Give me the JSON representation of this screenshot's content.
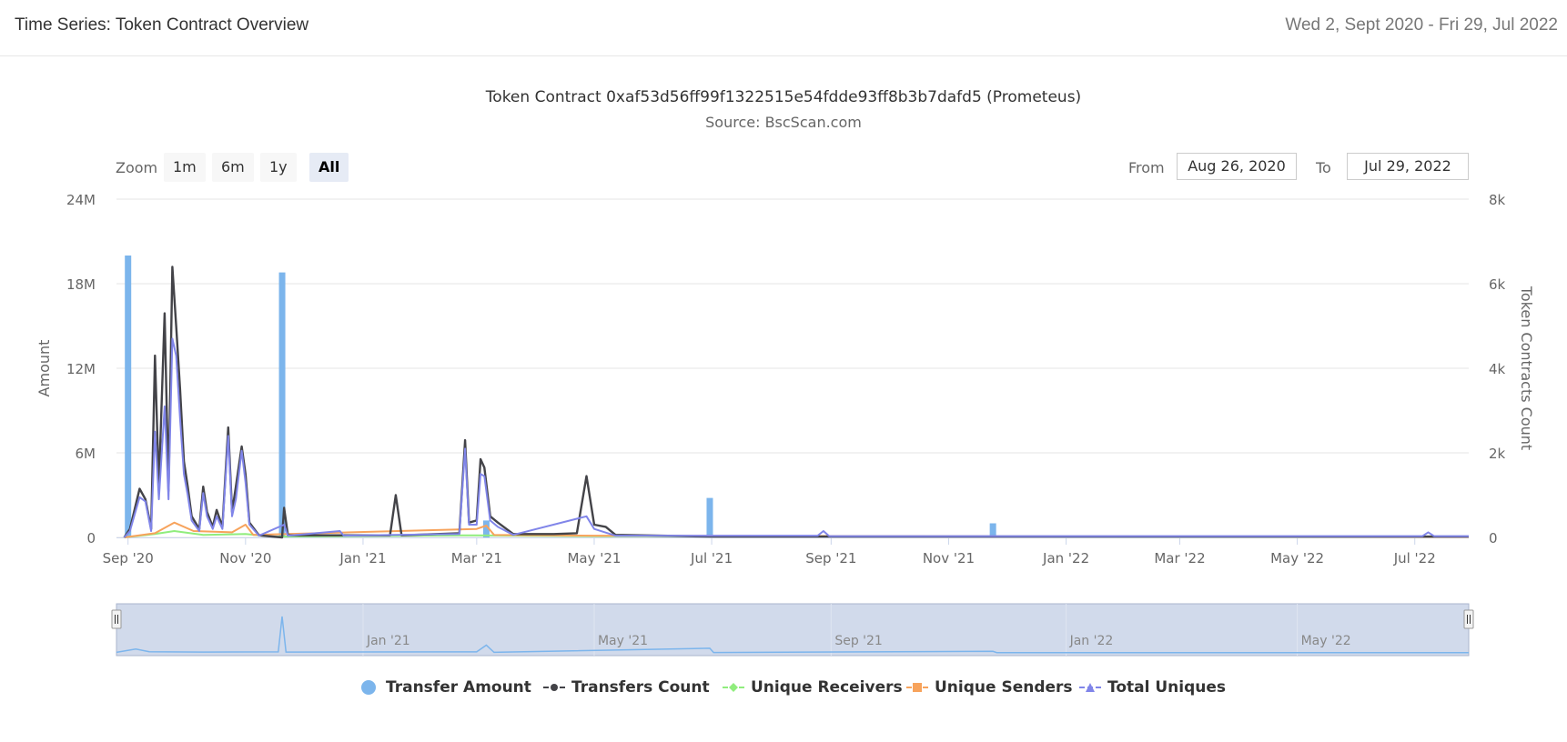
{
  "header": {
    "title": "Time Series: Token Contract Overview",
    "date_range": "Wed 2, Sept 2020 - Fri 29, Jul 2022"
  },
  "range_selector": {
    "zoom_label": "Zoom",
    "buttons": [
      "1m",
      "6m",
      "1y",
      "All"
    ],
    "active": "All",
    "from_label": "From",
    "from_value": "Aug 26, 2020",
    "to_label": "To",
    "to_value": "Jul 29, 2022"
  },
  "colors": {
    "transfer_amount": "#7cb5ec",
    "transfers_count": "#434348",
    "unique_receivers": "#90ed7d",
    "unique_senders": "#f7a35c",
    "total_uniques": "#8085e9",
    "grid": "#e6e6e6",
    "navigator_fill": "#c9d3e8"
  },
  "chart_data": {
    "type": "line",
    "title": "Token Contract 0xaf53d56ff99f1322515e54fdde93ff8b3b7dafd5 (Prometeus)",
    "subtitle": "Source: BscScan.com",
    "xlabel": "",
    "ylabel": "Amount",
    "y2label": "Token Contracts Count",
    "xlim": [
      "2020-08-26",
      "2022-07-29"
    ],
    "ylim": [
      0,
      24000000
    ],
    "y2lim": [
      0,
      8000
    ],
    "x_tick_labels": [
      "Sep '20",
      "Nov '20",
      "Jan '21",
      "Mar '21",
      "May '21",
      "Jul '21",
      "Sep '21",
      "Nov '21",
      "Jan '22",
      "Mar '22",
      "May '22",
      "Jul '22"
    ],
    "x_tick_dates": [
      "2020-09-01",
      "2020-11-01",
      "2021-01-01",
      "2021-03-01",
      "2021-05-01",
      "2021-07-01",
      "2021-09-01",
      "2021-11-01",
      "2022-01-01",
      "2022-03-01",
      "2022-05-01",
      "2022-07-01"
    ],
    "y_tick_labels": [
      "0",
      "6M",
      "12M",
      "18M",
      "24M"
    ],
    "y2_tick_labels": [
      "0",
      "2k",
      "4k",
      "6k",
      "8k"
    ],
    "grid": true,
    "legend_position": "bottom-center",
    "navigator_labels": [
      "Jan '21",
      "May '21",
      "Sep '21",
      "Jan '22",
      "May '22"
    ],
    "series": [
      {
        "name": "Transfer Amount",
        "type": "column",
        "axis": "left",
        "points": [
          [
            "2020-09-01",
            20000000
          ],
          [
            "2020-11-20",
            18800000
          ],
          [
            "2021-03-06",
            1200000
          ],
          [
            "2021-06-30",
            2800000
          ],
          [
            "2021-11-24",
            1000000
          ]
        ]
      },
      {
        "name": "Transfers Count",
        "type": "line",
        "axis": "right",
        "points": [
          [
            "2020-08-30",
            0
          ],
          [
            "2020-09-02",
            200
          ],
          [
            "2020-09-07",
            1150
          ],
          [
            "2020-09-10",
            900
          ],
          [
            "2020-09-13",
            200
          ],
          [
            "2020-09-15",
            4300
          ],
          [
            "2020-09-17",
            1200
          ],
          [
            "2020-09-20",
            5300
          ],
          [
            "2020-09-22",
            1100
          ],
          [
            "2020-09-24",
            6400
          ],
          [
            "2020-09-26",
            5000
          ],
          [
            "2020-09-28",
            3500
          ],
          [
            "2020-09-30",
            1800
          ],
          [
            "2020-10-02",
            1200
          ],
          [
            "2020-10-04",
            500
          ],
          [
            "2020-10-08",
            200
          ],
          [
            "2020-10-10",
            1200
          ],
          [
            "2020-10-12",
            600
          ],
          [
            "2020-10-15",
            250
          ],
          [
            "2020-10-17",
            650
          ],
          [
            "2020-10-20",
            250
          ],
          [
            "2020-10-23",
            2600
          ],
          [
            "2020-10-25",
            600
          ],
          [
            "2020-10-27",
            1200
          ],
          [
            "2020-10-30",
            2150
          ],
          [
            "2020-11-01",
            1500
          ],
          [
            "2020-11-03",
            350
          ],
          [
            "2020-11-08",
            50
          ],
          [
            "2020-11-20",
            0
          ],
          [
            "2020-11-21",
            700
          ],
          [
            "2020-11-23",
            50
          ],
          [
            "2020-12-15",
            50
          ],
          [
            "2021-01-15",
            50
          ],
          [
            "2021-01-18",
            1000
          ],
          [
            "2021-01-21",
            50
          ],
          [
            "2021-02-20",
            100
          ],
          [
            "2021-02-23",
            2300
          ],
          [
            "2021-02-25",
            350
          ],
          [
            "2021-03-01",
            400
          ],
          [
            "2021-03-03",
            1850
          ],
          [
            "2021-03-05",
            1650
          ],
          [
            "2021-03-08",
            500
          ],
          [
            "2021-03-12",
            350
          ],
          [
            "2021-03-20",
            80
          ],
          [
            "2021-04-10",
            80
          ],
          [
            "2021-04-22",
            100
          ],
          [
            "2021-04-27",
            1450
          ],
          [
            "2021-05-01",
            300
          ],
          [
            "2021-05-07",
            250
          ],
          [
            "2021-05-12",
            60
          ],
          [
            "2021-07-01",
            20
          ],
          [
            "2022-07-29",
            20
          ]
        ]
      },
      {
        "name": "Unique Receivers",
        "type": "line",
        "axis": "right",
        "points": [
          [
            "2020-08-30",
            0
          ],
          [
            "2020-09-15",
            80
          ],
          [
            "2020-09-25",
            150
          ],
          [
            "2020-10-10",
            60
          ],
          [
            "2020-11-01",
            80
          ],
          [
            "2020-11-15",
            20
          ],
          [
            "2021-03-01",
            50
          ],
          [
            "2021-05-01",
            30
          ],
          [
            "2022-07-29",
            10
          ]
        ]
      },
      {
        "name": "Unique Senders",
        "type": "line",
        "axis": "right",
        "points": [
          [
            "2020-08-30",
            0
          ],
          [
            "2020-09-15",
            100
          ],
          [
            "2020-09-25",
            350
          ],
          [
            "2020-10-05",
            150
          ],
          [
            "2020-10-25",
            120
          ],
          [
            "2020-11-01",
            300
          ],
          [
            "2020-11-05",
            60
          ],
          [
            "2021-03-01",
            200
          ],
          [
            "2021-03-06",
            280
          ],
          [
            "2021-03-10",
            60
          ],
          [
            "2021-05-01",
            40
          ],
          [
            "2022-07-29",
            10
          ]
        ]
      },
      {
        "name": "Total Uniques",
        "type": "line",
        "axis": "right",
        "points": [
          [
            "2020-08-30",
            0
          ],
          [
            "2020-09-02",
            150
          ],
          [
            "2020-09-07",
            950
          ],
          [
            "2020-09-10",
            850
          ],
          [
            "2020-09-13",
            150
          ],
          [
            "2020-09-15",
            2500
          ],
          [
            "2020-09-17",
            900
          ],
          [
            "2020-09-20",
            3100
          ],
          [
            "2020-09-22",
            900
          ],
          [
            "2020-09-24",
            4700
          ],
          [
            "2020-09-26",
            4300
          ],
          [
            "2020-09-28",
            2800
          ],
          [
            "2020-09-30",
            1500
          ],
          [
            "2020-10-02",
            1000
          ],
          [
            "2020-10-04",
            400
          ],
          [
            "2020-10-08",
            150
          ],
          [
            "2020-10-10",
            1050
          ],
          [
            "2020-10-12",
            500
          ],
          [
            "2020-10-15",
            200
          ],
          [
            "2020-10-17",
            500
          ],
          [
            "2020-10-20",
            200
          ],
          [
            "2020-10-23",
            2400
          ],
          [
            "2020-10-25",
            500
          ],
          [
            "2020-10-27",
            900
          ],
          [
            "2020-10-30",
            2050
          ],
          [
            "2020-11-01",
            1300
          ],
          [
            "2020-11-03",
            300
          ],
          [
            "2020-11-08",
            40
          ],
          [
            "2020-11-21",
            300
          ],
          [
            "2020-11-23",
            40
          ],
          [
            "2020-12-20",
            150
          ],
          [
            "2020-12-22",
            40
          ],
          [
            "2021-02-20",
            80
          ],
          [
            "2021-02-23",
            2100
          ],
          [
            "2021-02-25",
            300
          ],
          [
            "2021-03-01",
            300
          ],
          [
            "2021-03-03",
            1500
          ],
          [
            "2021-03-05",
            1450
          ],
          [
            "2021-03-08",
            400
          ],
          [
            "2021-03-12",
            250
          ],
          [
            "2021-03-20",
            60
          ],
          [
            "2021-04-27",
            500
          ],
          [
            "2021-05-01",
            200
          ],
          [
            "2021-05-12",
            40
          ],
          [
            "2021-08-25",
            40
          ],
          [
            "2021-08-28",
            150
          ],
          [
            "2021-08-31",
            30
          ],
          [
            "2022-07-05",
            30
          ],
          [
            "2022-07-08",
            120
          ],
          [
            "2022-07-11",
            30
          ],
          [
            "2022-07-29",
            30
          ]
        ]
      }
    ]
  },
  "legend": [
    {
      "label": "Transfer Amount",
      "key": "transfer_amount"
    },
    {
      "label": "Transfers Count",
      "key": "transfers_count"
    },
    {
      "label": "Unique Receivers",
      "key": "unique_receivers"
    },
    {
      "label": "Unique Senders",
      "key": "unique_senders"
    },
    {
      "label": "Total Uniques",
      "key": "total_uniques"
    }
  ]
}
